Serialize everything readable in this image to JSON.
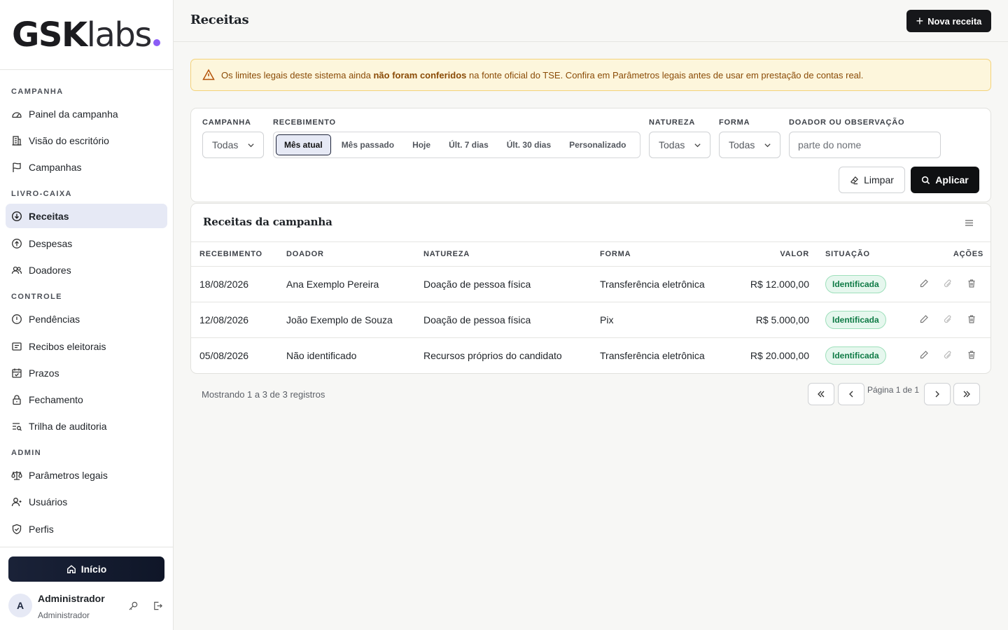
{
  "brand": {
    "name_bold": "GSK",
    "name_light": "labs",
    "dot_color": "#8b5cf6"
  },
  "sidebar": {
    "groups": [
      {
        "title": "CAMPANHA",
        "items": [
          {
            "label": "Painel da campanha",
            "icon": "gauge-icon"
          },
          {
            "label": "Visão do escritório",
            "icon": "building-icon"
          },
          {
            "label": "Campanhas",
            "icon": "flag-icon"
          }
        ]
      },
      {
        "title": "LIVRO-CAIXA",
        "items": [
          {
            "label": "Receitas",
            "icon": "arrow-down-circle-icon",
            "active": true
          },
          {
            "label": "Despesas",
            "icon": "arrow-up-circle-icon"
          },
          {
            "label": "Doadores",
            "icon": "users-icon"
          }
        ]
      },
      {
        "title": "CONTROLE",
        "items": [
          {
            "label": "Pendências",
            "icon": "alert-circle-icon"
          },
          {
            "label": "Recibos eleitorais",
            "icon": "receipt-icon"
          },
          {
            "label": "Prazos",
            "icon": "calendar-check-icon"
          },
          {
            "label": "Fechamento",
            "icon": "lock-icon"
          },
          {
            "label": "Trilha de auditoria",
            "icon": "list-search-icon"
          }
        ]
      },
      {
        "title": "ADMIN",
        "items": [
          {
            "label": "Parâmetros legais",
            "icon": "scale-icon"
          },
          {
            "label": "Usuários",
            "icon": "user-plus-icon"
          },
          {
            "label": "Perfis",
            "icon": "shield-check-icon"
          }
        ]
      }
    ],
    "home_button": "Início",
    "user": {
      "initial": "A",
      "name": "Administrador",
      "role": "Administrador"
    }
  },
  "header": {
    "title": "Receitas",
    "new_button": "Nova receita"
  },
  "alert": {
    "text_before": "Os limites legais deste sistema ainda ",
    "text_bold": "não foram conferidos",
    "text_after": " na fonte oficial do TSE. Confira em Parâmetros legais antes de usar em prestação de contas real."
  },
  "filters": {
    "campanha": {
      "label": "CAMPANHA",
      "value": "Todas"
    },
    "recebimento": {
      "label": "RECEBIMENTO",
      "options": [
        "Mês atual",
        "Mês passado",
        "Hoje",
        "Últ. 7 dias",
        "Últ. 30 dias",
        "Personalizado"
      ],
      "selected": "Mês atual"
    },
    "natureza": {
      "label": "NATUREZA",
      "value": "Todas"
    },
    "forma": {
      "label": "FORMA",
      "value": "Todas"
    },
    "doador": {
      "label": "DOADOR OU OBSERVAÇÃO",
      "placeholder": "parte do nome"
    },
    "clear_button": "Limpar",
    "apply_button": "Aplicar"
  },
  "table": {
    "title": "Receitas da campanha",
    "columns": [
      "RECEBIMENTO",
      "DOADOR",
      "NATUREZA",
      "FORMA",
      "VALOR",
      "SITUAÇÃO",
      "AÇÕES"
    ],
    "rows": [
      {
        "date": "18/08/2026",
        "donor": "Ana Exemplo Pereira",
        "nature": "Doação de pessoa física",
        "form": "Transferência eletrônica",
        "value": "R$ 12.000,00",
        "status": "Identificada"
      },
      {
        "date": "12/08/2026",
        "donor": "João Exemplo de Souza",
        "nature": "Doação de pessoa física",
        "form": "Pix",
        "value": "R$ 5.000,00",
        "status": "Identificada"
      },
      {
        "date": "05/08/2026",
        "donor": "Não identificado",
        "nature": "Recursos próprios do candidato",
        "form": "Transferência eletrônica",
        "value": "R$ 20.000,00",
        "status": "Identificada"
      }
    ]
  },
  "pagination": {
    "info": "Mostrando 1 a 3 de 3 registros",
    "page_label": "Página 1 de 1"
  }
}
